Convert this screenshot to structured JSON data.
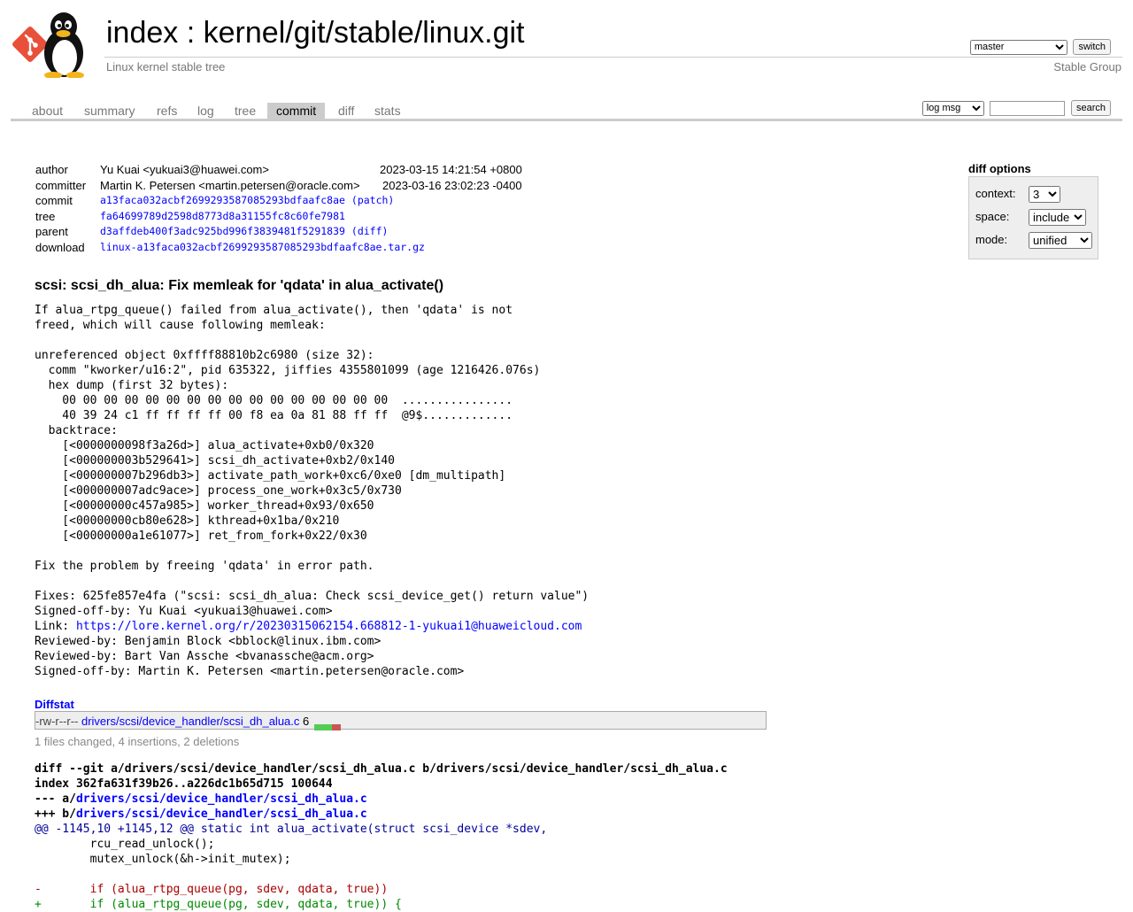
{
  "header": {
    "index_link": "index",
    "separator": ":",
    "repo_path": "kernel/git/stable/linux.git",
    "description": "Linux kernel stable tree",
    "owner": "Stable Group",
    "branch": "master",
    "switch_label": "switch"
  },
  "tabs": [
    "about",
    "summary",
    "refs",
    "log",
    "tree",
    "commit",
    "diff",
    "stats"
  ],
  "active_tab": "commit",
  "search": {
    "mode": "log msg",
    "value": "",
    "button": "search"
  },
  "commit": {
    "author_label": "author",
    "author": "Yu Kuai <yukuai3@huawei.com>",
    "author_date": "2023-03-15 14:21:54 +0800",
    "committer_label": "committer",
    "committer": "Martin K. Petersen <martin.petersen@oracle.com>",
    "committer_date": "2023-03-16 23:02:23 -0400",
    "commit_label": "commit",
    "commit_id": "a13faca032acbf2699293587085293bdfaafc8ae",
    "patch_link": "(patch)",
    "tree_label": "tree",
    "tree_id": "fa64699789d2598d8773d8a31155fc8c60fe7981",
    "parent_label": "parent",
    "parent_id": "d3affdeb400f3adc925bd996f3839481f5291839",
    "diff_link": "(diff)",
    "download_label": "download",
    "download": "linux-a13faca032acbf2699293587085293bdfaafc8ae.tar.gz",
    "subject": "scsi: scsi_dh_alua: Fix memleak for 'qdata' in alua_activate()",
    "message_top": "If alua_rtpg_queue() failed from alua_activate(), then 'qdata' is not\nfreed, which will cause following memleak:\n\nunreferenced object 0xffff88810b2c6980 (size 32):\n  comm \"kworker/u16:2\", pid 635322, jiffies 4355801099 (age 1216426.076s)\n  hex dump (first 32 bytes):\n    00 00 00 00 00 00 00 00 00 00 00 00 00 00 00 00  ................\n    40 39 24 c1 ff ff ff ff 00 f8 ea 0a 81 88 ff ff  @9$.............\n  backtrace:\n    [<0000000098f3a26d>] alua_activate+0xb0/0x320\n    [<000000003b529641>] scsi_dh_activate+0xb2/0x140\n    [<000000007b296db3>] activate_path_work+0xc6/0xe0 [dm_multipath]\n    [<000000007adc9ace>] process_one_work+0x3c5/0x730\n    [<00000000c457a985>] worker_thread+0x93/0x650\n    [<00000000cb80e628>] kthread+0x1ba/0x210\n    [<00000000a1e61077>] ret_from_fork+0x22/0x30\n\nFix the problem by freeing 'qdata' in error path.\n\nFixes: 625fe857e4fa (\"scsi: scsi_dh_alua: Check scsi_device_get() return value\")\nSigned-off-by: Yu Kuai <yukuai3@huawei.com>",
    "link_prefix": "Link: ",
    "link_url": "https://lore.kernel.org/r/20230315062154.668812-1-yukuai1@huaweicloud.com",
    "message_bottom": "Reviewed-by: Benjamin Block <bblock@linux.ibm.com>\nReviewed-by: Bart Van Assche <bvanassche@acm.org>\nSigned-off-by: Martin K. Petersen <martin.petersen@oracle.com>"
  },
  "diff_options": {
    "title": "diff options",
    "context_label": "context:",
    "context": "3",
    "space_label": "space:",
    "space": "include",
    "mode_label": "mode:",
    "mode": "unified"
  },
  "diffstat": {
    "title": "Diffstat",
    "mode": "-rw-r--r--",
    "file": "drivers/scsi/device_handler/scsi_dh_alua.c",
    "changes": "6",
    "summary": "1 files changed, 4 insertions, 2 deletions",
    "insertions": 4,
    "deletions": 2
  },
  "diff": {
    "git_line": "diff --git a/drivers/scsi/device_handler/scsi_dh_alua.c b/drivers/scsi/device_handler/scsi_dh_alua.c",
    "index_line": "index 362fa631f39b26..a226dc1b65d715 100644",
    "minus_prefix": "--- a/",
    "plus_prefix": "+++ b/",
    "file_path": "drivers/scsi/device_handler/scsi_dh_alua.c",
    "hunk": "@@ -1145,10 +1145,12 @@ static int alua_activate(struct scsi_device *sdev,",
    "ctx1": "        rcu_read_unlock();",
    "ctx2": "        mutex_unlock(&h->init_mutex);",
    "ctx3": "",
    "del1": "-       if (alua_rtpg_queue(pg, sdev, qdata, true))",
    "add1": "+       if (alua_rtpg_queue(pg, sdev, qdata, true)) {"
  }
}
